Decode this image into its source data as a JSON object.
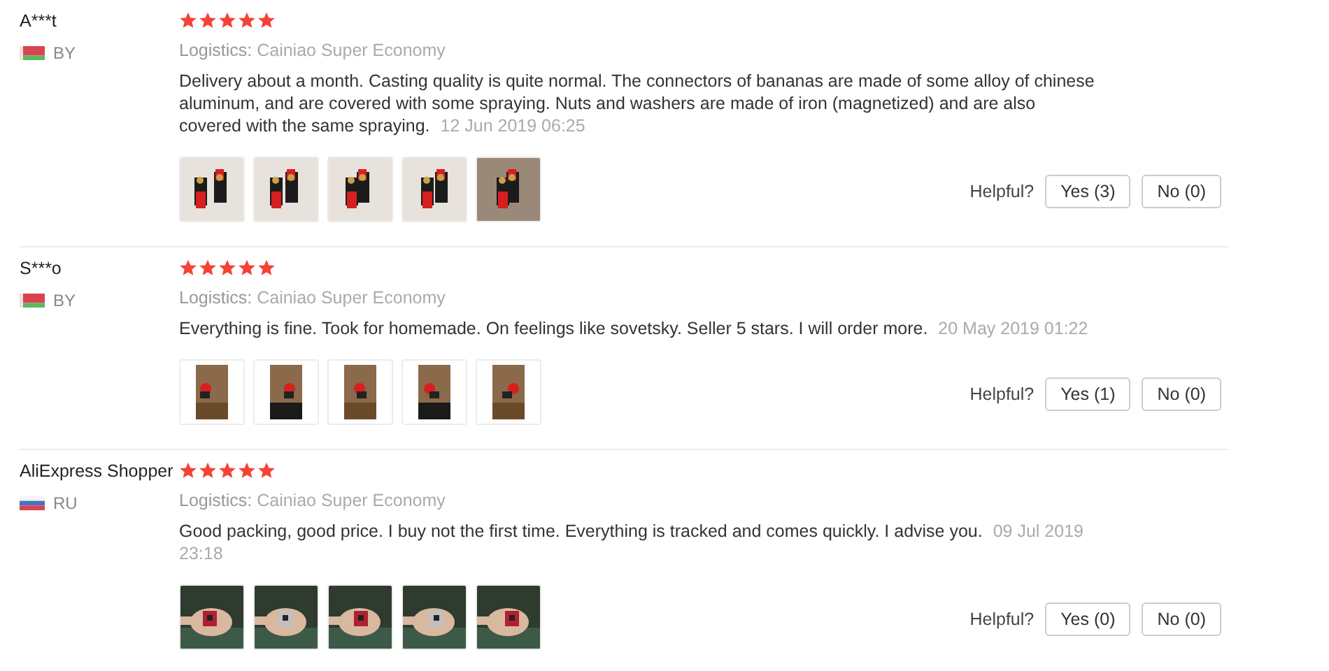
{
  "reviews": [
    {
      "name": "A***t",
      "kind": "by",
      "country": "BY",
      "stars": 5,
      "logistics_label": "Logistics:",
      "logistics": "Cainiao Super Economy",
      "text": "Delivery about a month. Casting quality is quite normal. The connectors of bananas are made of some alloy of chinese aluminum, and are covered with some spraying. Nuts and washers are made of iron (magnetized) and are also covered with the same spraying.",
      "date": "12 Jun 2019 06:25",
      "photos": [
        {
          "kind": "picture"
        },
        {
          "kind": "picture"
        },
        {
          "kind": "picture"
        },
        {
          "kind": "picture"
        },
        {
          "kind": "picture"
        }
      ],
      "helpful_label": "Helpful?",
      "yes": "Yes (3)",
      "no": "No (0)"
    },
    {
      "name": "S***o",
      "kind": "by",
      "country": "BY",
      "stars": 5,
      "logistics_label": "Logistics:",
      "logistics": "Cainiao Super Economy",
      "text": "Everything is fine. Took for homemade. On feelings like sovetsky. Seller 5 stars. I will order more.",
      "date": "20 May 2019 01:22",
      "photos": [
        {
          "kind": "picture"
        },
        {
          "kind": "picture"
        },
        {
          "kind": "picture"
        },
        {
          "kind": "picture"
        },
        {
          "kind": "picture"
        }
      ],
      "helpful_label": "Helpful?",
      "yes": "Yes (1)",
      "no": "No (0)"
    },
    {
      "name": "AliExpress Shopper",
      "kind": "ru",
      "country": "RU",
      "stars": 5,
      "logistics_label": "Logistics:",
      "logistics": "Cainiao Super Economy",
      "text": "Good packing, good price. I buy not the first time. Everything is tracked and comes quickly. I advise you.",
      "date": "09 Jul 2019 23:18",
      "photos": [
        {
          "kind": "picture"
        },
        {
          "kind": "picture"
        },
        {
          "kind": "picture"
        },
        {
          "kind": "picture"
        },
        {
          "kind": "picture"
        }
      ],
      "helpful_label": "Helpful?",
      "yes": "Yes (0)",
      "no": "No (0)"
    }
  ]
}
